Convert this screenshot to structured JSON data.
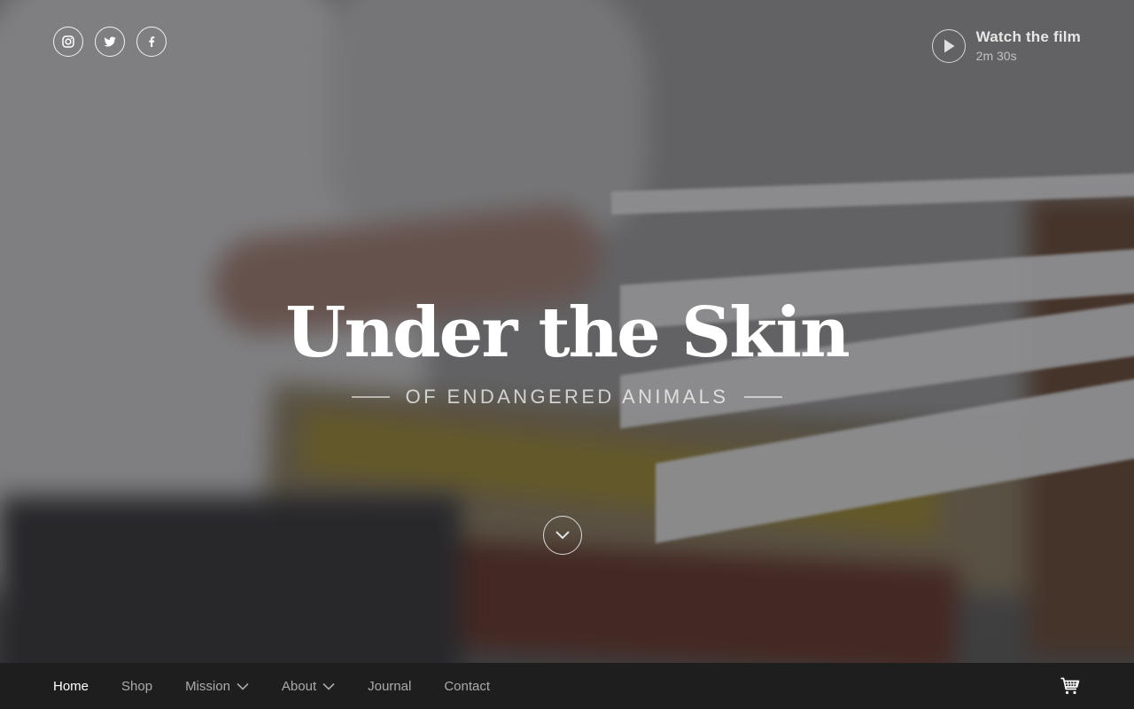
{
  "social": {
    "items": [
      {
        "icon": "instagram-icon"
      },
      {
        "icon": "twitter-icon"
      },
      {
        "icon": "facebook-icon"
      }
    ]
  },
  "film": {
    "title": "Watch the film",
    "duration": "2m 30s",
    "icon": "play-icon"
  },
  "hero": {
    "title": "Under the Skin",
    "subtitle": "OF ENDANGERED ANIMALS",
    "scroll_icon": "chevron-down-icon"
  },
  "nav": {
    "items": [
      {
        "label": "Home",
        "active": true
      },
      {
        "label": "Shop"
      },
      {
        "label": "Mission",
        "dropdown": true
      },
      {
        "label": "About",
        "dropdown": true
      },
      {
        "label": "Journal"
      },
      {
        "label": "Contact"
      }
    ],
    "cart_icon": "cart-icon"
  },
  "colors": {
    "nav_bg": "#1e1e1e",
    "text": "#ffffff"
  }
}
